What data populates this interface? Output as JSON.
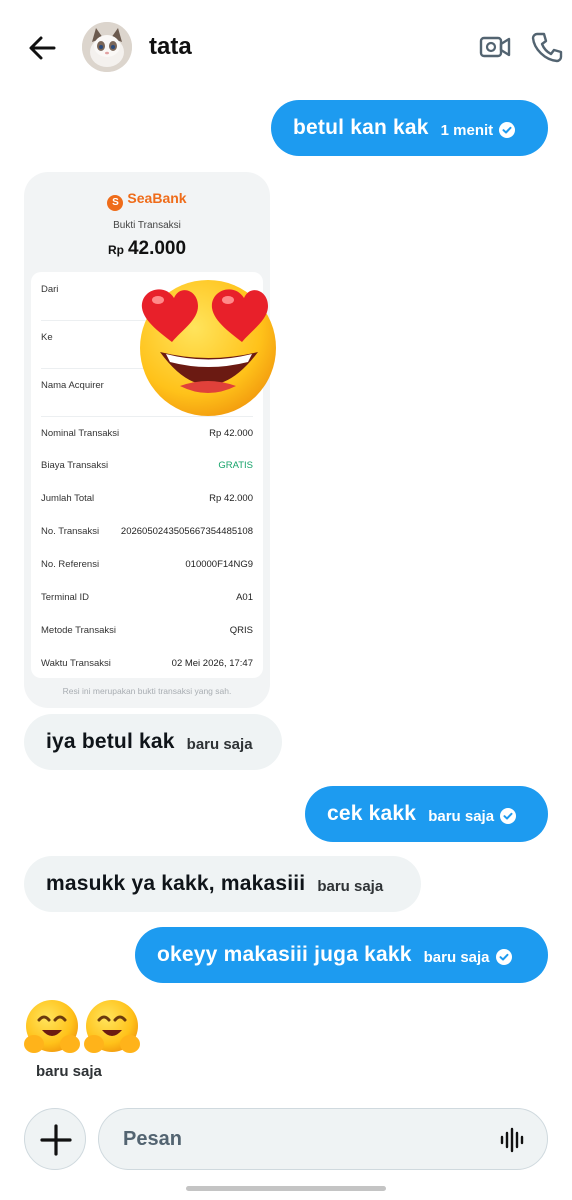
{
  "header": {
    "contact_name": "tata",
    "icons": [
      "back-arrow-icon",
      "video-call-icon",
      "phone-call-icon"
    ]
  },
  "messages": [
    {
      "direction": "out",
      "text": "betul kan kak",
      "time": "1 menit",
      "status": "sent"
    },
    {
      "direction": "in",
      "type": "image",
      "reaction": "heart-eyes-emoji"
    },
    {
      "direction": "in",
      "text": "iya betul kak",
      "time": "baru saja"
    },
    {
      "direction": "out",
      "text": "cek kakk",
      "time": "baru saja",
      "status": "sent"
    },
    {
      "direction": "in",
      "text": "masukk ya kakk, makasiii",
      "time": "baru saja"
    },
    {
      "direction": "out",
      "text": "okeyy makasiii juga kakk",
      "time": "baru saja",
      "status": "sent"
    },
    {
      "direction": "in",
      "type": "emoji",
      "emoji": "hugging-face-emoji x2",
      "time": "baru saja"
    }
  ],
  "receipt": {
    "brand": "SeaBank",
    "title": "Bukti Transaksi",
    "currency": "Rp",
    "amount": "42.000",
    "rows": [
      {
        "label": "Dari",
        "value": ""
      },
      {
        "label": "Ke",
        "value": ""
      },
      {
        "label": "Nama Acquirer",
        "value": ""
      },
      {
        "label": "Nominal Transaksi",
        "value": "Rp 42.000"
      },
      {
        "label": "Biaya Transaksi",
        "value": "GRATIS"
      },
      {
        "label": "Jumlah Total",
        "value": "Rp 42.000"
      },
      {
        "label": "No. Transaksi",
        "value": "20260502435056673544851​08"
      },
      {
        "label": "No. Referensi",
        "value": "010000F14NG9"
      },
      {
        "label": "Terminal ID",
        "value": "A01"
      },
      {
        "label": "Metode Transaksi",
        "value": "QRIS"
      },
      {
        "label": "Waktu Transaksi",
        "value": "02 Mei 2026, 17:47"
      }
    ],
    "footnote": "Resi ini merupakan bukti transaksi yang sah."
  },
  "composer": {
    "placeholder": "Pesan",
    "icons": [
      "plus-icon",
      "voice-wave-icon"
    ]
  },
  "colors": {
    "outgoing_bubble": "#1d9bf0",
    "incoming_bubble": "#eff3f4",
    "seabank_orange": "#ef6c1a"
  }
}
